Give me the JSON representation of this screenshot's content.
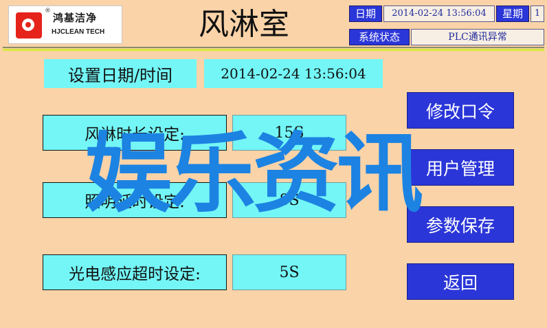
{
  "header": {
    "logo_cn": "鸿基洁净",
    "logo_en": "HJCLEAN TECH",
    "logo_mark": "®",
    "title": "风淋室",
    "date_label": "日期",
    "datetime_value": "2014-02-24 13:56:04",
    "weekday_label": "星期",
    "weekday_value": "1",
    "status_label": "系统状态",
    "status_value": "PLC通讯异常"
  },
  "main": {
    "set_datetime_label": "设置日期/时间",
    "set_datetime_value": "2014-02-24  13:56:04",
    "settings": [
      {
        "label": "风淋时长设定:",
        "value": "15S"
      },
      {
        "label": "照明延时设定:",
        "value": "8S"
      },
      {
        "label": "光电感应超时设定:",
        "value": "5S"
      }
    ],
    "buttons": [
      {
        "label": "修改口令"
      },
      {
        "label": "用户管理"
      },
      {
        "label": "参数保存"
      },
      {
        "label": "返回"
      }
    ]
  },
  "overlay": {
    "watermark": "娱乐资讯"
  },
  "colors": {
    "background": "#fad3a8",
    "cyan": "#74f6f6",
    "button_blue": "#2b36d8",
    "watermark": "#1c83e2",
    "logo_red": "#e5231b"
  }
}
